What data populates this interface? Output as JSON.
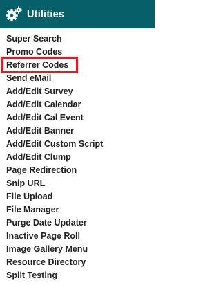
{
  "header": {
    "title": "Utilities",
    "icon": "gears-icon"
  },
  "menu": {
    "items": [
      {
        "label": "Super Search"
      },
      {
        "label": "Promo Codes"
      },
      {
        "label": "Referrer Codes"
      },
      {
        "label": "Send eMail"
      },
      {
        "label": "Add/Edit Survey"
      },
      {
        "label": "Add/Edit Calendar"
      },
      {
        "label": "Add/Edit Cal Event"
      },
      {
        "label": "Add/Edit Banner"
      },
      {
        "label": "Add/Edit Custom Script"
      },
      {
        "label": "Add/Edit Clump"
      },
      {
        "label": "Page Redirection"
      },
      {
        "label": "Snip URL"
      },
      {
        "label": "File Upload"
      },
      {
        "label": "File Manager"
      },
      {
        "label": "Purge Date Updater"
      },
      {
        "label": "Inactive Page Roll"
      },
      {
        "label": "Image Gallery Menu"
      },
      {
        "label": "Resource Directory"
      },
      {
        "label": "Split Testing"
      }
    ]
  },
  "colors": {
    "header_bg": "#065f69",
    "highlight": "#e01b24",
    "text": "#222222"
  }
}
